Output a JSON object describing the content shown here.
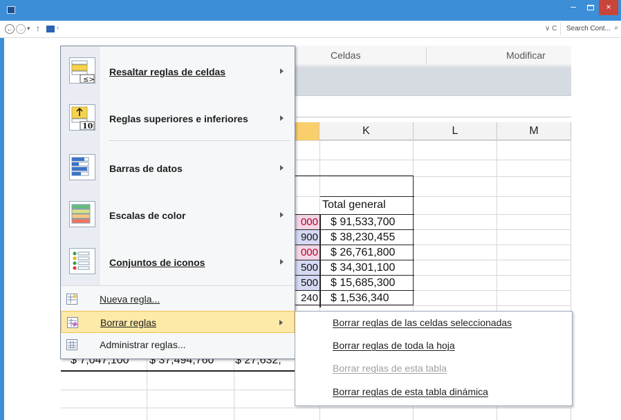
{
  "window": {
    "minimize": "–",
    "close": "×"
  },
  "address_bar": {
    "back": "←",
    "forward": "→",
    "dropdown": "▾",
    "up": "↑",
    "sep": "›",
    "refresh_group": "∨ C",
    "search_placeholder": "Search Cont...",
    "search_icon": "⌕"
  },
  "ribbon": {
    "group_cells": "Celdas",
    "group_modify": "Modificar"
  },
  "columns": [
    "K",
    "L",
    "M"
  ],
  "pivot": {
    "total_header": "Total general",
    "values": [
      "$ 91,533,700",
      "$ 38,230,455",
      "$ 26,761,800",
      "$ 34,301,100",
      "$ 15,685,300",
      "$ 1,536,340"
    ],
    "j_values": [
      "000",
      "900",
      "000",
      "500",
      "500",
      "240"
    ],
    "bottom_totals": [
      "$ 7,047,100",
      "$ 37,494,760",
      "$ 27,632,"
    ]
  },
  "menu": {
    "items": [
      {
        "label": "Resaltar reglas de celdas"
      },
      {
        "label": "Reglas superiores e inferiores"
      },
      {
        "label": "Barras de datos"
      },
      {
        "label": "Escalas de color"
      },
      {
        "label": "Conjuntos de iconos"
      }
    ],
    "nueva": "Nueva regla...",
    "borrar": "Borrar reglas",
    "administrar": "Administrar reglas..."
  },
  "submenu": {
    "items": [
      {
        "label": "Borrar reglas de las celdas seleccionadas",
        "enabled": true
      },
      {
        "label": "Borrar reglas de toda la hoja",
        "enabled": true
      },
      {
        "label": "Borrar reglas de esta tabla",
        "enabled": false
      },
      {
        "label": "Borrar reglas de esta tabla dinámica",
        "enabled": true
      }
    ]
  },
  "colors": {
    "titlebar": "#3c8fd6",
    "close": "#c8453c",
    "highlight": "#fde9a8"
  }
}
